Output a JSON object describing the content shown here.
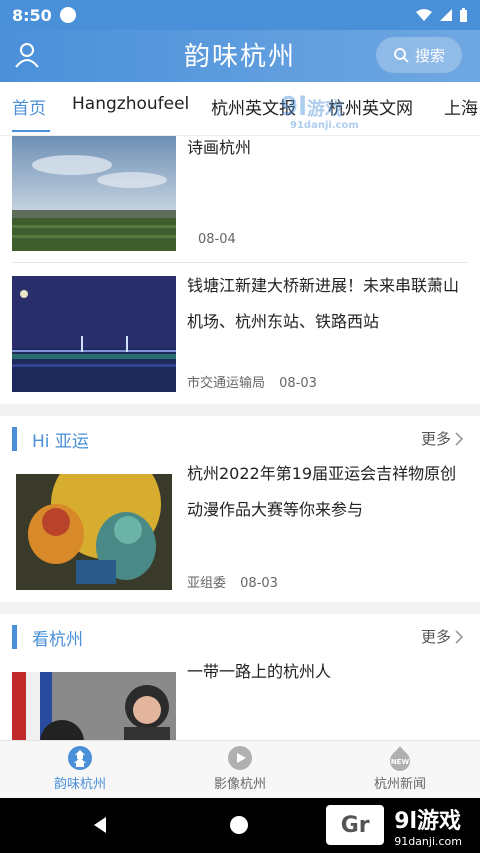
{
  "status": {
    "time": "8:50"
  },
  "header": {
    "title": "韵味杭州",
    "search_label": "搜索"
  },
  "tabs": [
    {
      "label": "首页"
    },
    {
      "label": "Hangzhoufeel"
    },
    {
      "label": "杭州英文报"
    },
    {
      "label": "杭州英文网"
    },
    {
      "label": "上海"
    }
  ],
  "news_top": [
    {
      "title": "诗画杭州",
      "source": "",
      "date": "08-04"
    },
    {
      "title": "钱塘江新建大桥新进展！未来串联萧山机场、杭州东站、铁路西站",
      "source": "市交通运输局",
      "date": "08-03"
    }
  ],
  "section_asian_games": {
    "title": "Hi 亚运",
    "more": "更多",
    "item": {
      "title": "杭州2022年第19届亚运会吉祥物原创动漫作品大赛等你来参与",
      "source": "亚组委",
      "date": "08-03"
    }
  },
  "section_see": {
    "title": "看杭州",
    "more": "更多",
    "item": {
      "title": "一带一路上的杭州人"
    }
  },
  "bottom_nav": [
    {
      "label": "韵味杭州"
    },
    {
      "label": "影像杭州"
    },
    {
      "label": "杭州新闻"
    }
  ],
  "watermark": {
    "brand": "9l游戏",
    "domain": "91danji.com"
  },
  "colors": {
    "accent": "#4a90d9"
  }
}
